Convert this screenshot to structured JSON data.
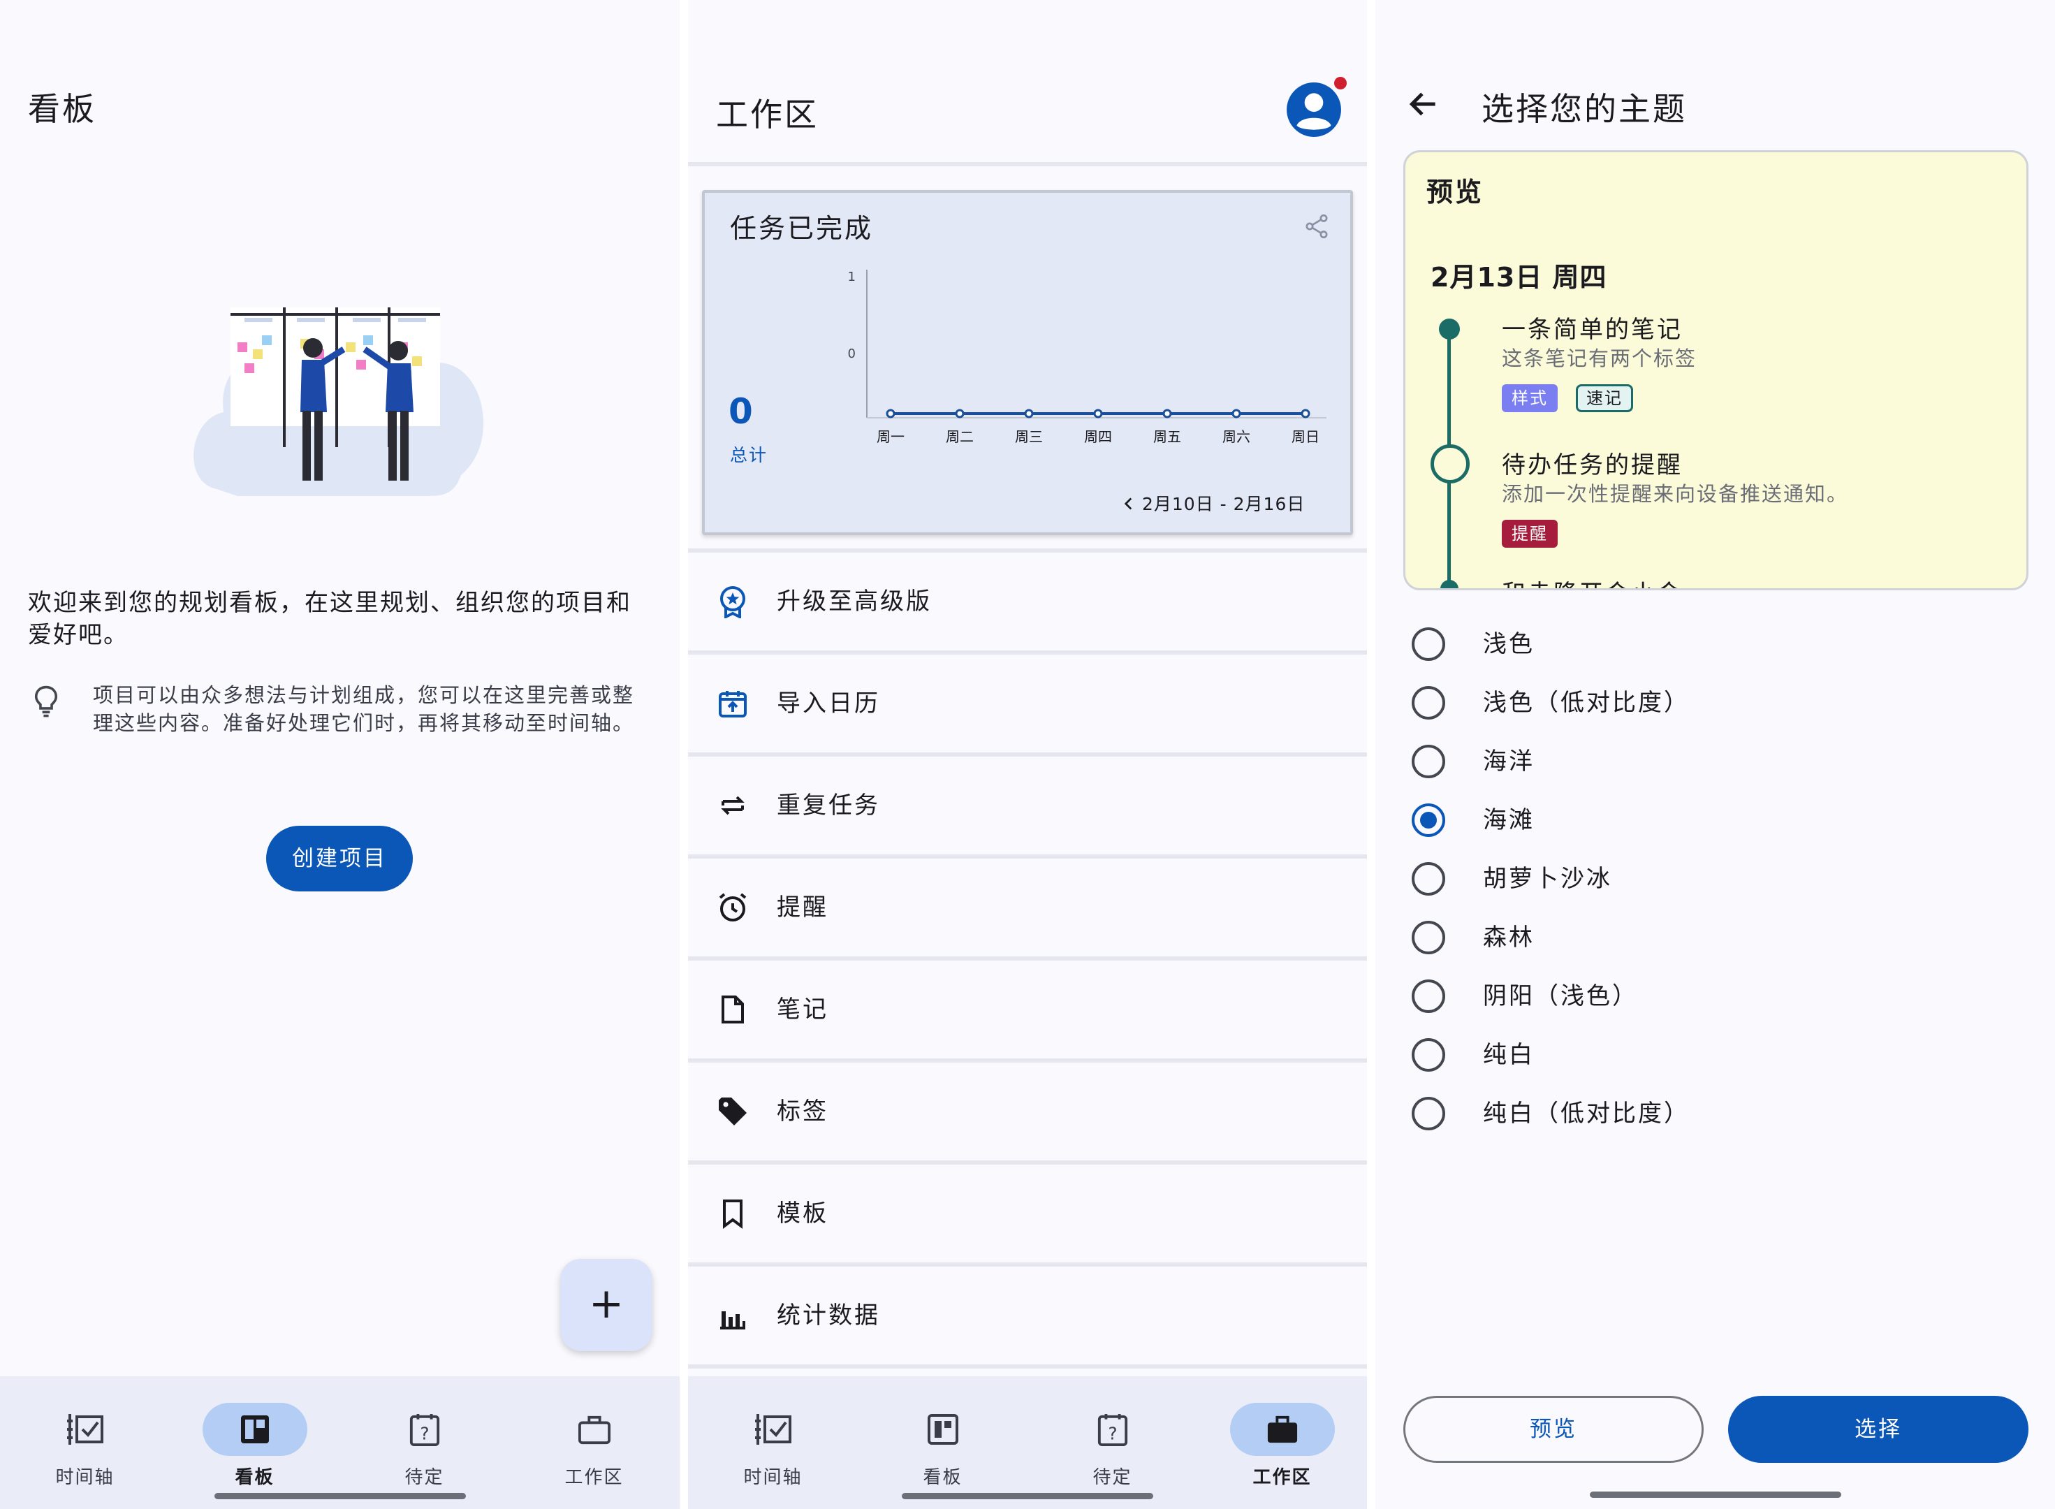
{
  "kanban": {
    "title": "看板",
    "welcome": "欢迎来到您的规划看板，在这里规划、组织您的项目和爱好吧。",
    "tip": "项目可以由众多想法与计划组成，您可以在这里完善或整理这些内容。准备好处理它们时，再将其移动至时间轴。",
    "create_button": "创建项目",
    "fab_label": "+"
  },
  "workspace": {
    "title": "工作区",
    "chart_card": {
      "title": "任务已完成",
      "total_value": "0",
      "total_label": "总计",
      "range": "2月10日 - 2月16日"
    },
    "menu": [
      {
        "label": "升级至高级版",
        "icon": "premium-badge-icon"
      },
      {
        "label": "导入日历",
        "icon": "calendar-import-icon"
      },
      {
        "label": "重复任务",
        "icon": "repeat-icon"
      },
      {
        "label": "提醒",
        "icon": "alarm-icon"
      },
      {
        "label": "笔记",
        "icon": "note-icon"
      },
      {
        "label": "标签",
        "icon": "tag-icon"
      },
      {
        "label": "模板",
        "icon": "bookmark-icon"
      },
      {
        "label": "统计数据",
        "icon": "bar-chart-icon"
      }
    ]
  },
  "chart_data": {
    "type": "line",
    "title": "任务已完成",
    "categories": [
      "周一",
      "周二",
      "周三",
      "周四",
      "周五",
      "周六",
      "周日"
    ],
    "values": [
      0,
      0,
      0,
      0,
      0,
      0,
      0
    ],
    "y_ticks": [
      "1",
      "0"
    ],
    "ylim": [
      0,
      1
    ],
    "grid": false,
    "color": "#1a4f9c"
  },
  "theme": {
    "title": "选择您的主题",
    "preview_title": "预览",
    "date": "2月13日 周四",
    "items": [
      {
        "title": "一条简单的笔记",
        "sub": "这条笔记有两个标签",
        "tags": [
          "样式",
          "速记"
        ]
      },
      {
        "title": "待办任务的提醒",
        "sub": "添加一次性提醒来向设备推送通知。",
        "tags": [
          "提醒"
        ]
      },
      {
        "title": "和赤隆开会小会"
      }
    ],
    "options": [
      "浅色",
      "浅色（低对比度）",
      "海洋",
      "海滩",
      "胡萝卜沙冰",
      "森林",
      "阴阳（浅色）",
      "纯白",
      "纯白（低对比度）"
    ],
    "selected_index": 3,
    "preview_button": "预览",
    "select_button": "选择"
  },
  "nav": [
    "时间轴",
    "看板",
    "待定",
    "工作区"
  ],
  "colors": {
    "primary": "#0b57b8",
    "nav_active": "#b4cdf5",
    "preview_bg": "#fbfbd9",
    "timeline": "#1b6b66",
    "tag_purple": "#7b7ef0",
    "tag_red": "#a61c3c"
  }
}
